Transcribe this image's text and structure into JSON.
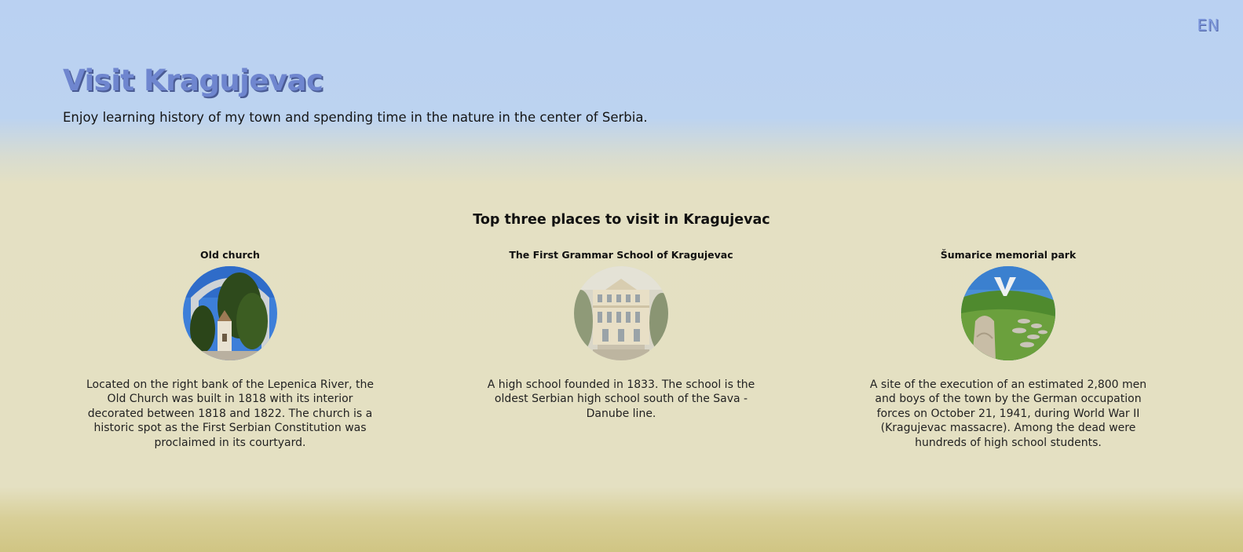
{
  "header": {
    "lang": "EN",
    "title": "Visit Kragujevac",
    "subtitle": "Enjoy learning history of my town and spending time in the nature in the center of Serbia."
  },
  "places_section": {
    "title": "Top three places to visit in Kragujevac",
    "items": [
      {
        "title": "Old church",
        "description": "Located on the right bank of the Lepenica River, the Old Church was built in 1818 with its interior decorated between 1818 and 1822. The church is a historic spot as the First Serbian Constitution was proclaimed in its courtyard."
      },
      {
        "title": "The First Grammar School of Kragujevac",
        "description": "A high school founded in 1833. The school is the oldest Serbian high school south of the Sava - Danube line."
      },
      {
        "title": "Šumarice memorial park",
        "description": "A site of the execution of an estimated 2,800 men and boys of the town by the German occupation forces on October 21, 1941, during World War II (Kragujevac massacre). Among the dead were hundreds of high school students."
      }
    ]
  },
  "colors": {
    "title": "#6f86cf",
    "title_shadow": "#4a5b94",
    "sky": "#bad1f2",
    "sand": "#e4e0c2"
  }
}
